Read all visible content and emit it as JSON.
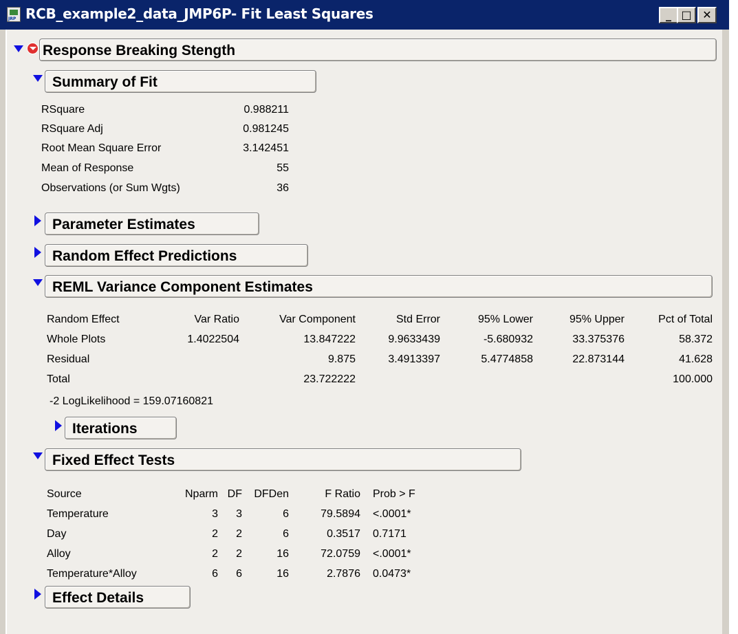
{
  "window": {
    "title": "RCB_example2_data_JMP6P- Fit Least Squares",
    "minimize": "_",
    "maximize": "□",
    "close": "✕"
  },
  "response": {
    "label": "Response Breaking Stength"
  },
  "summary": {
    "label": "Summary of Fit",
    "rows": [
      {
        "name": "RSquare",
        "value": "0.988211"
      },
      {
        "name": "RSquare Adj",
        "value": "0.981245"
      },
      {
        "name": "Root Mean Square Error",
        "value": "3.142451"
      },
      {
        "name": "Mean of Response",
        "value": "55"
      },
      {
        "name": "Observations (or Sum Wgts)",
        "value": "36"
      }
    ]
  },
  "param_estimates": {
    "label": "Parameter Estimates"
  },
  "random_effect": {
    "label": "Random Effect Predictions"
  },
  "reml": {
    "label": "REML Variance Component Estimates",
    "columns": [
      "Random Effect",
      "Var Ratio",
      "Var Component",
      "Std Error",
      "95% Lower",
      "95% Upper",
      "Pct of Total"
    ],
    "rows": [
      [
        "Whole Plots",
        "1.4022504",
        "13.847222",
        "9.9633439",
        "-5.680932",
        "33.375376",
        "58.372"
      ],
      [
        "Residual",
        "",
        "9.875",
        "3.4913397",
        "5.4774858",
        "22.873144",
        "41.628"
      ],
      [
        "Total",
        "",
        "23.722222",
        "",
        "",
        "",
        "100.000"
      ]
    ],
    "loglik": "-2 LogLikelihood =  159.07160821"
  },
  "iterations": {
    "label": "Iterations"
  },
  "fixed": {
    "label": "Fixed Effect Tests",
    "columns": [
      "Source",
      "Nparm",
      "DF",
      "DFDen",
      "F Ratio",
      "Prob > F"
    ],
    "rows": [
      [
        "Temperature",
        "3",
        "3",
        "6",
        "79.5894",
        "<.0001*"
      ],
      [
        "Day",
        "2",
        "2",
        "6",
        "0.3517",
        "0.7171"
      ],
      [
        "Alloy",
        "2",
        "2",
        "16",
        "72.0759",
        "<.0001*"
      ],
      [
        "Temperature*Alloy",
        "6",
        "6",
        "16",
        "2.7876",
        "0.0473*"
      ]
    ]
  },
  "effect_details": {
    "label": "Effect Details"
  },
  "colors": {
    "titlebar": "#0a246a",
    "panel": "#d4d0c8",
    "disclosure": "#1010e0",
    "menu": "#e03030"
  }
}
